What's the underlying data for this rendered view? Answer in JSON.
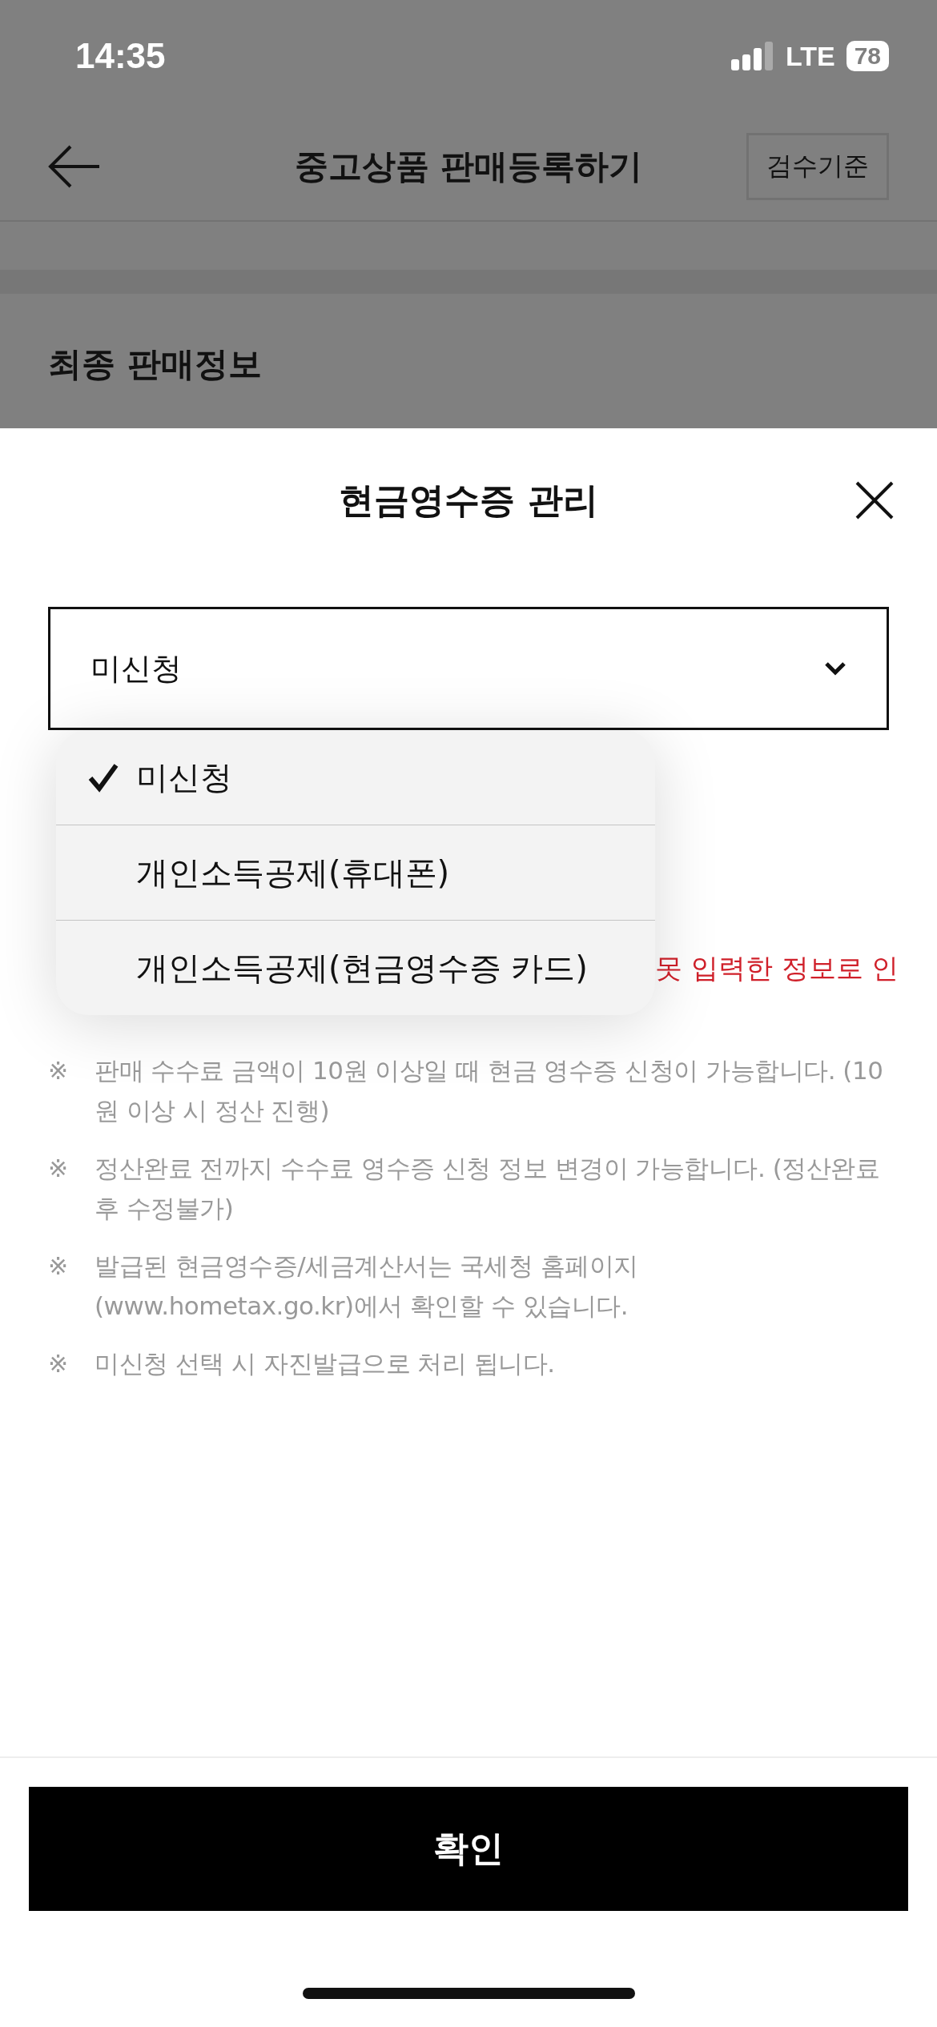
{
  "status_bar": {
    "time": "14:35",
    "network": "LTE",
    "battery": "78"
  },
  "header": {
    "title": "중고상품 판매등록하기",
    "action": "검수기준"
  },
  "background": {
    "section_title": "최종 판매정보"
  },
  "sheet": {
    "title": "현금영수증 관리",
    "select": {
      "value": "미신청"
    },
    "options": [
      {
        "label": "미신청",
        "selected": true
      },
      {
        "label": "개인소득공제(휴대폰)",
        "selected": false
      },
      {
        "label": "개인소득공제(현금영수증 카드)",
        "selected": false
      }
    ],
    "warning_fragment": "못 입력한 정보로 인",
    "notes": [
      {
        "mark": "※",
        "text": "판매 수수료 금액이 10원 이상일 때 현금 영수증 신청이 가능합니다. (10원 이상 시 정산 진행)"
      },
      {
        "mark": "※",
        "text": "정산완료 전까지 수수료 영수증 신청 정보 변경이 가능합니다. (정산완료 후 수정불가)"
      },
      {
        "mark": "※",
        "text": "발급된 현금영수증/세금계산서는 국세청 홈페이지 (www.hometax.go.kr)에서 확인할 수 있습니다."
      },
      {
        "mark": "※",
        "text": "미신청 선택 시 자진발급으로 처리 됩니다."
      }
    ],
    "confirm": "확인"
  }
}
